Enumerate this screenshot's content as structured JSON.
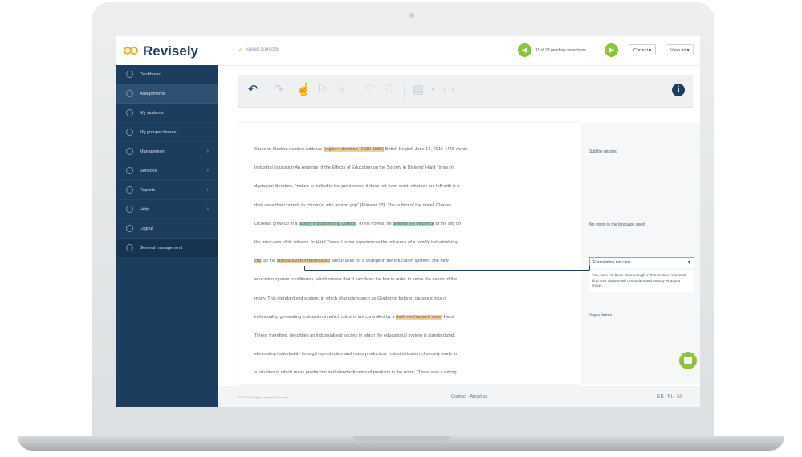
{
  "app": {
    "logo_text": "Revisely",
    "save_status": "Saved correctly"
  },
  "topbar": {
    "prev_icon": "arrow-left-icon",
    "next_icon": "arrow-right-icon",
    "nav_text": "11 of 23 pending corrections",
    "comment_dropdown": "Correct",
    "view_dropdown": "View as"
  },
  "sidebar": {
    "items": [
      {
        "label": "Dashboard",
        "icon": "home-icon",
        "has_submenu": false
      },
      {
        "label": "Assignments",
        "icon": "assignment-icon",
        "has_submenu": false,
        "active": true
      },
      {
        "label": "My students",
        "icon": "students-icon",
        "has_submenu": false
      },
      {
        "label": "My groups/classes",
        "icon": "groups-icon",
        "has_submenu": false
      },
      {
        "label": "Management",
        "icon": "management-icon",
        "has_submenu": true
      },
      {
        "label": "Services",
        "icon": "services-icon",
        "has_submenu": true
      },
      {
        "label": "Reports",
        "icon": "reports-icon",
        "has_submenu": true
      },
      {
        "label": "Help",
        "icon": "help-icon",
        "has_submenu": true
      },
      {
        "label": "Logout",
        "icon": "logout-icon",
        "has_submenu": false
      },
      {
        "label": "General management",
        "icon": "settings-icon",
        "has_submenu": false
      }
    ]
  },
  "toolbar": {
    "info_label": "i"
  },
  "document": {
    "lines": [
      {
        "segments": [
          {
            "t": "Student: Student number Address "
          },
          {
            "t": "English Literature (1830-1880)",
            "hl": "y"
          },
          {
            "t": " British English June 14, 2016 1475 words"
          }
        ]
      },
      {
        "segments": [
          {
            "t": "Industrial Education An Analysis of the Effects of Education on the Society in Dickens' Hard Times In"
          }
        ]
      },
      {
        "segments": [
          {
            "t": "dystopian literature, \"nature is sullied to the point where it does not even exist, what we are left with is a"
          }
        ]
      },
      {
        "segments": [
          {
            "t": "dark state that controls its citizen[s] with an iron grip\" (Elander 13). The author of the novel, Charles"
          }
        ]
      },
      {
        "segments": [
          {
            "t": "Dickens, grew up in a "
          },
          {
            "t": "rapidly industrializing London",
            "hl": "g"
          },
          {
            "t": ". In his novels, he "
          },
          {
            "t": "defined the influence",
            "hl": "g"
          },
          {
            "t": " of the city on"
          }
        ]
      },
      {
        "segments": [
          {
            "t": "the mind-sets of its citizens. In Hard Times, Louisa experiences the influence of a rapidly industrializing"
          }
        ]
      },
      {
        "segments": [
          {
            "t": "city",
            "hl": "y"
          },
          {
            "t": ", as the "
          },
          {
            "t": "standardized industrialized",
            "hl": "y"
          },
          {
            "t": " labour asks for a change in the education system. The new"
          }
        ]
      },
      {
        "segments": [
          {
            "t": "education system is utilitarian, which means that it sacrifices the few in order to serve the needs of the"
          }
        ]
      },
      {
        "segments": [
          {
            "t": "many. This standardized system, in which characters such as Gradgrind belong, causes a loss of"
          }
        ]
      },
      {
        "segments": [
          {
            "t": "individuality, generating a situation in which citizens are controlled by a "
          },
          {
            "t": "dark mechanized state.",
            "hl": "y"
          },
          {
            "t": " Hard"
          }
        ]
      },
      {
        "segments": [
          {
            "t": "Times, therefore, describes an industrialised society in which the educational system is standardized,"
          }
        ]
      },
      {
        "segments": [
          {
            "t": "eliminating individuality through reproduction and mass production. Industrialization of society leads to"
          }
        ]
      },
      {
        "segments": [
          {
            "t": "a situation in which mass production and standardization of products is the norm. \"There was a rotting"
          }
        ]
      }
    ]
  },
  "comments": {
    "c1": "Subtitle missing",
    "c2": "No errors in the language used",
    "c3_title": "Formulation not clear",
    "c3_body": "You have not been clear enough in this section. You must find your readers will not understand exactly what you mean.",
    "c4": "Vague terms"
  },
  "footer": {
    "copyright": "© 2016 All rights reserved Revisely",
    "links": "Contact · About us",
    "lang": "EN · NL · ES"
  },
  "colors": {
    "brand_navy": "#1c3d5e",
    "accent_green": "#8cc43c",
    "logo_orange": "#f0a92a",
    "highlight_yellow": "#f2cf94",
    "highlight_green": "#9fd9b3"
  }
}
